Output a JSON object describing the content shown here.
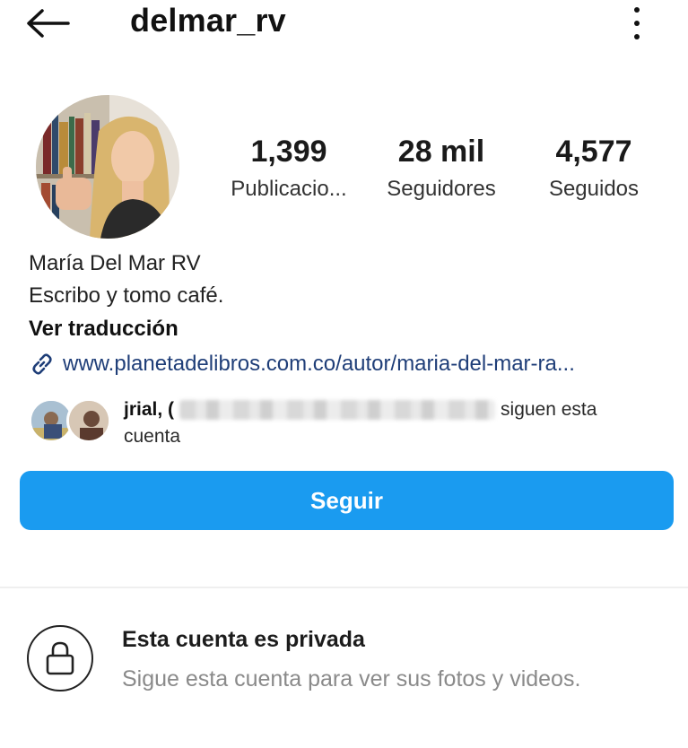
{
  "header": {
    "username": "delmar_rv",
    "back_icon": "arrow-left-icon",
    "more_icon": "more-vertical-icon"
  },
  "profile": {
    "avatar_icon": "profile-photo",
    "stats": [
      {
        "value": "1,399",
        "label": "Publicacio..."
      },
      {
        "value": "28 mil",
        "label": "Seguidores"
      },
      {
        "value": "4,577",
        "label": "Seguidos"
      }
    ]
  },
  "bio": {
    "name": "María Del Mar RV",
    "text": "Escribo y tomo café.",
    "translate": "Ver traducción",
    "link": "www.planetadelibros.com.co/autor/maria-del-mar-ra...",
    "link_icon": "link-icon"
  },
  "followed_by": {
    "first_user": "jrial, (",
    "suffix": "siguen esta cuenta"
  },
  "actions": {
    "follow_label": "Seguir",
    "follow_color": "#1a9bf0"
  },
  "private": {
    "title": "Esta cuenta es privada",
    "subtitle": "Sigue esta cuenta para ver sus fotos y videos.",
    "icon": "lock-icon"
  }
}
